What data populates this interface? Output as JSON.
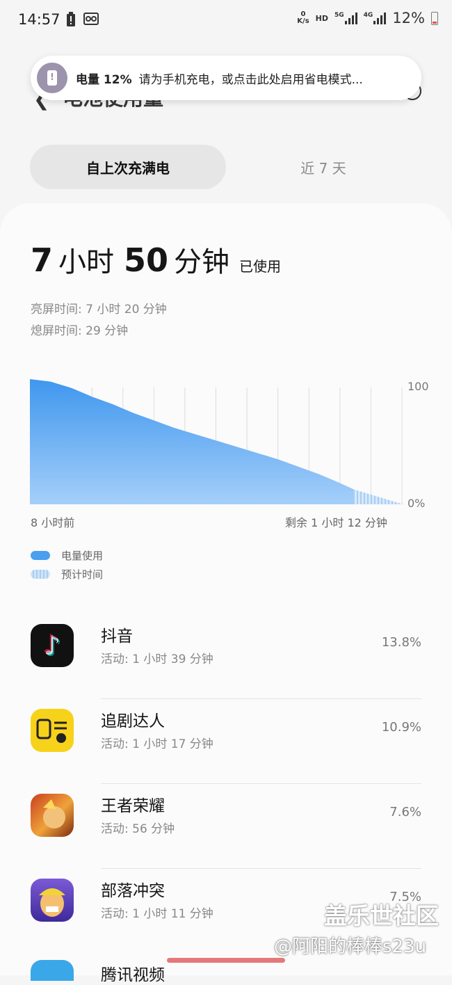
{
  "status_bar": {
    "time": "14:57",
    "net_speed_top": "0",
    "net_speed_bottom": "K/s",
    "hd": "HD",
    "sim1": "5G",
    "sim2": "4G",
    "battery_pct": "12%"
  },
  "header": {
    "title": "电池使用量"
  },
  "notification": {
    "bold": "电量 12%",
    "text": "请为手机充电，或点击此处启用省电模式..."
  },
  "tabs": [
    {
      "label": "自上次充满电",
      "active": true
    },
    {
      "label": "近 7 天",
      "active": false
    }
  ],
  "usage": {
    "hours": "7",
    "hours_unit": "小时",
    "minutes": "50",
    "minutes_unit": "分钟",
    "suffix": "已使用",
    "screen_on": "亮屏时间:  7 小时 20 分钟",
    "screen_off": "熄屏时间:   29 分钟"
  },
  "chart_data": {
    "type": "area",
    "y_top_label": "100",
    "y_bottom_label": "0%",
    "x_left_label": "8 小时前",
    "x_right_label": "剩余 1 小时 12 分钟",
    "ylim": [
      0,
      100
    ],
    "series": [
      {
        "name": "电量使用",
        "x_hours": [
          0,
          0.5,
          1,
          1.5,
          2,
          2.5,
          3,
          3.5,
          4,
          4.5,
          5,
          5.5,
          6,
          6.5,
          7,
          7.5,
          7.83
        ],
        "values": [
          100,
          98,
          93,
          86,
          80,
          73,
          67,
          61,
          56,
          51,
          46,
          41,
          36,
          30,
          24,
          17,
          12
        ]
      },
      {
        "name": "预计时间",
        "x_hours": [
          7.83,
          9.03
        ],
        "values": [
          12,
          0
        ]
      }
    ],
    "grid": true
  },
  "legend": [
    {
      "label": "电量使用"
    },
    {
      "label": "预计时间"
    }
  ],
  "apps": [
    {
      "name": "抖音",
      "activity": "活动:  1 小时 39 分钟",
      "percent": "13.8%"
    },
    {
      "name": "追剧达人",
      "activity": "活动:  1 小时 17 分钟",
      "percent": "10.9%"
    },
    {
      "name": "王者荣耀",
      "activity": "活动:  56 分钟",
      "percent": "7.6%"
    },
    {
      "name": "部落冲突",
      "activity": "活动:  1 小时 11 分钟",
      "percent": "7.5%"
    },
    {
      "name": "腾讯视频"
    }
  ],
  "watermark": {
    "line1": "盖乐世社区",
    "line2": "@阿阳的棒棒s23u"
  },
  "colors": {
    "accent": "#4a9ff0",
    "notice_icon": "#9c93ad",
    "home_bar": "#e57878"
  }
}
